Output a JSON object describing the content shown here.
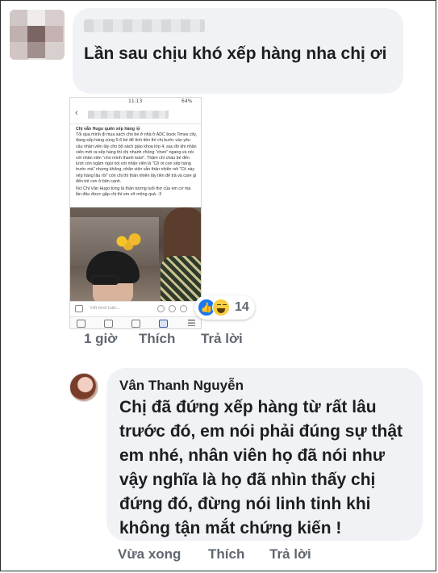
{
  "comment1": {
    "text": "Lần sau chịu khó xếp hàng nha chị ơi",
    "actions": {
      "time": "1 giờ",
      "like": "Thích",
      "reply": "Trả lời"
    },
    "attachment": {
      "status_time": "11:13",
      "status_battery": "64%",
      "post_title": "Chị vẫn Hugo quên xếp hàng 😀",
      "post_body": "Tối qua mình đi mua sách cho bé ở nhà ở ADC book Times city, đang xếp hàng cùng 5-6 bé để tính tiền thì chị bước vào yêu cầu nhân viên lấy cho bộ sách giáo khoa lớp 4, sau đó khi nhân viên mới ra xếp hàng thì chị nhanh chồng \"chen\" ngang và nói với nhân viên \"cho mình thanh toán\". Thậm chí cháu bé đến lượt còn ngậm ngùi nói với nhân viên là \"Cô ơi con xếp hàng trước mà\" nhưng không, nhân viên vẫn thản nhiên nói \"Cô này xếp hàng lâu rồi\" còn chị thì thản nhiên lấy tiền để trả và care gì đến trẻ con ở bên cạnh.",
      "post_sub": "Ncl Chị Vân Hugo từng là thần tượng tuổi thơ của em cơ mà lần đầu được gặp chị thì em vỡ mộng quá. :3",
      "comment_placeholder": "Viết bình luận...",
      "reaction_count": "14"
    }
  },
  "comment2": {
    "author": "Vân Thanh Nguyễn",
    "text": "Chị đã đứng xếp hàng từ rất lâu trước đó, em nói phải đúng sự thật em nhé, nhân viên họ đã nói như vậy nghĩa là họ đã nhìn thấy chị đứng đó, đừng nói linh tinh khi không tận mắt chứng kiến !",
    "actions": {
      "time": "Vừa xong",
      "like": "Thích",
      "reply": "Trả lời"
    }
  },
  "colors": {
    "bubble_bg": "#f0f2f5",
    "text": "#1c1e21",
    "meta": "#606770",
    "like_blue": "#1877f2",
    "haha_yellow": "#f7cd46"
  }
}
